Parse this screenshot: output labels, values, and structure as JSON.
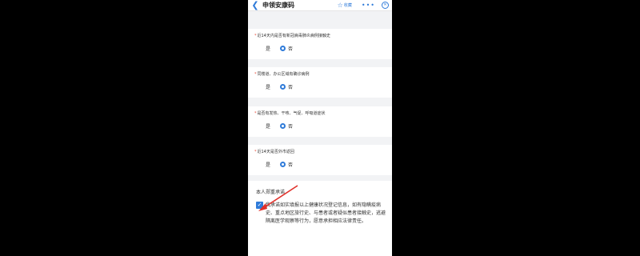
{
  "header": {
    "title": "申领安康码",
    "favorite_label": "收藏",
    "more_glyph": "•••"
  },
  "questions": [
    {
      "required_mark": "*",
      "text": "近14天内是否有新冠病毒肺炎病例接触史",
      "options": [
        "是",
        "否"
      ],
      "selected": "否"
    },
    {
      "required_mark": "*",
      "text": "同楼道、办公区域有确诊病例",
      "options": [
        "是",
        "否"
      ],
      "selected": "否"
    },
    {
      "required_mark": "*",
      "text": "是否有发热、干咳、气促、呼吸道症状",
      "options": [
        "是",
        "否"
      ],
      "selected": "否"
    },
    {
      "required_mark": "*",
      "text": "近14天是否外市返回",
      "options": [
        "是",
        "否"
      ],
      "selected": "否"
    }
  ],
  "commitment": {
    "title": "本人郑重承诺",
    "checked": true,
    "text": "我承诺如实填报以上健康状况登记信息，如有隐瞒疫病史、重点地区旅行史、与患者或者疑似患者接触史，逃避隔离医学观察等行为，愿意承担相应法律责任。"
  },
  "colors": {
    "accent": "#2f7bd9",
    "required": "#e84b3a",
    "annotation_arrow": "#e0302a"
  }
}
